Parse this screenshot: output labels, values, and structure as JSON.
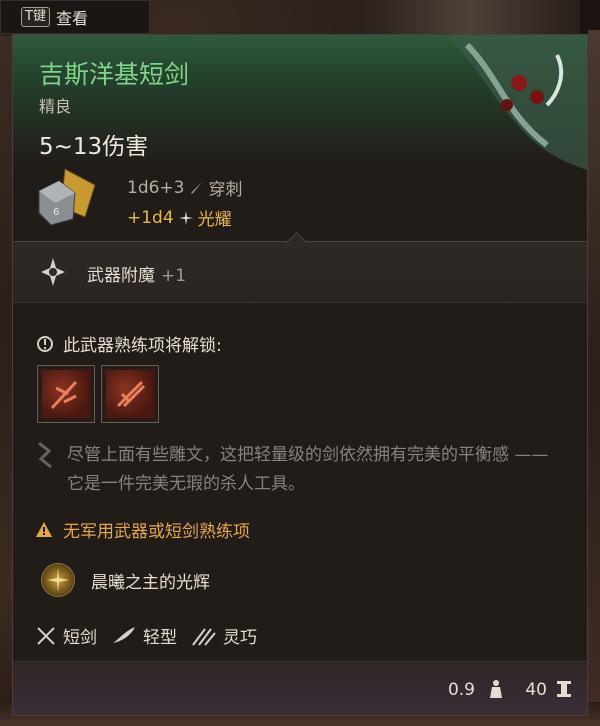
{
  "hint": {
    "key": "T键",
    "label": "查看"
  },
  "item": {
    "name": "吉斯洋基短剑",
    "rarity": "精良",
    "damage_range": "5~13伤害",
    "damage_dice": "1d6+3",
    "damage_type": "穿刺",
    "bonus_dice": "+1d4",
    "bonus_type": "光耀",
    "enchant_label": "武器附魔",
    "enchant_value": "+1",
    "proficiency_title": "此武器熟练项将解锁:",
    "description": "尽管上面有些雕文，这把轻量级的剑依然拥有完美的平衡感 —— 它是一件完美无瑕的杀人工具。",
    "warning": "无军用武器或短剑熟练项",
    "passive": "晨曦之主的光辉",
    "properties": [
      "短剑",
      "轻型",
      "灵巧"
    ],
    "weight": "0.9",
    "value": "40"
  },
  "colors": {
    "title": "#7fd48a",
    "bonus": "#e6b84a",
    "warning": "#e2a84a",
    "header_bg": "#2f5a3a"
  }
}
